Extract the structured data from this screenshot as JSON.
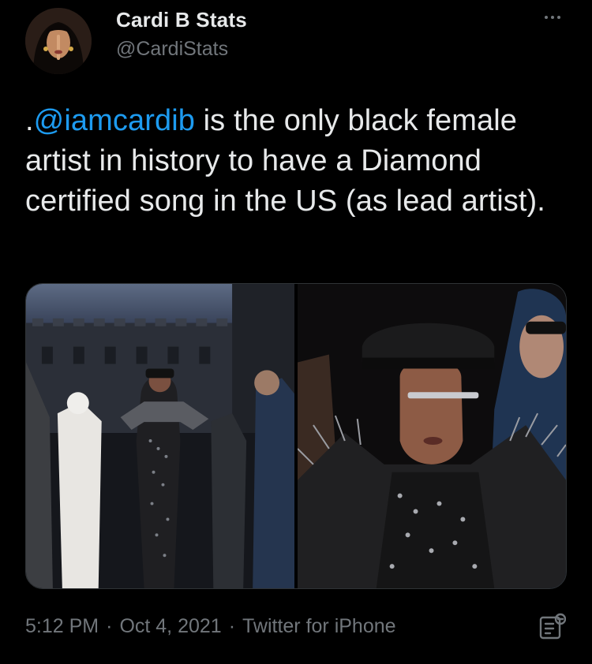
{
  "author": {
    "display_name": "Cardi B Stats",
    "handle": "@CardiStats",
    "avatar_icon": "profile-avatar"
  },
  "tweet": {
    "prefix": ".",
    "mention": "@iamcardib",
    "text": " is the only black female artist in history to have a Diamond certified song in the US (as lead artist).",
    "media": [
      {
        "icon": "photo-full-body"
      },
      {
        "icon": "photo-close-up"
      }
    ]
  },
  "meta": {
    "time": "5:12 PM",
    "separator": "·",
    "date": "Oct 4, 2021",
    "source": "Twitter for iPhone"
  },
  "colors": {
    "background": "#000000",
    "text": "#e7e9ea",
    "secondary": "#71767b",
    "link": "#1d9bf0",
    "border": "#2f3336"
  }
}
